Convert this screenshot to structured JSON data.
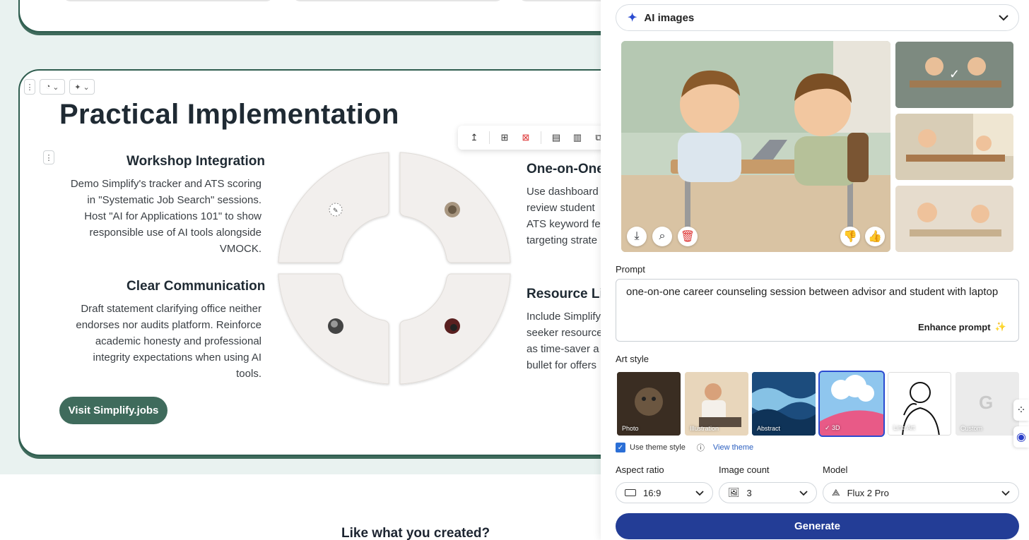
{
  "slide": {
    "title": "Practical Implementation",
    "blocks": [
      {
        "title": "Workshop Integration",
        "lines": [
          "Demo Simplify's tracker and ATS scoring",
          "in \"Systematic Job Search\" sessions.",
          "Host \"AI for Applications 101\" to show",
          "responsible use of AI tools alongside",
          "VMOCK."
        ]
      },
      {
        "title": "Clear Communication",
        "lines": [
          "Draft statement clarifying office neither",
          "endorses nor audits platform. Reinforce",
          "academic honesty and professional",
          "integrity expectations when using AI",
          "tools."
        ]
      },
      {
        "title": "One-on-One",
        "lines": [
          "Use dashboard",
          "review student",
          "ATS keyword fe",
          "targeting strate"
        ]
      },
      {
        "title": "Resource Li",
        "lines": [
          "Include Simplify",
          "seeker resource",
          "as time-saver a",
          "bullet for offers"
        ]
      }
    ],
    "cta": "Visit Simplify.jobs"
  },
  "bottom": {
    "title": "Like what you created?"
  },
  "panel": {
    "mode": "AI images",
    "prompt_label": "Prompt",
    "prompt_value": "one-on-one career counseling session between advisor and student with laptop",
    "enhance_label": "Enhance prompt",
    "art_style_label": "Art style",
    "styles": [
      {
        "label": "Photo"
      },
      {
        "label": "Illustration"
      },
      {
        "label": "Abstract"
      },
      {
        "label": "3D",
        "selected": true
      },
      {
        "label": "Line Art"
      },
      {
        "label": "Custom"
      }
    ],
    "use_theme_label": "Use theme style",
    "view_theme_label": "View theme",
    "aspect_label": "Aspect ratio",
    "aspect_value": "16:9",
    "count_label": "Image count",
    "count_value": "3",
    "model_label": "Model",
    "model_value": "Flux 2 Pro",
    "generate_label": "Generate",
    "accent": "#233d96"
  }
}
